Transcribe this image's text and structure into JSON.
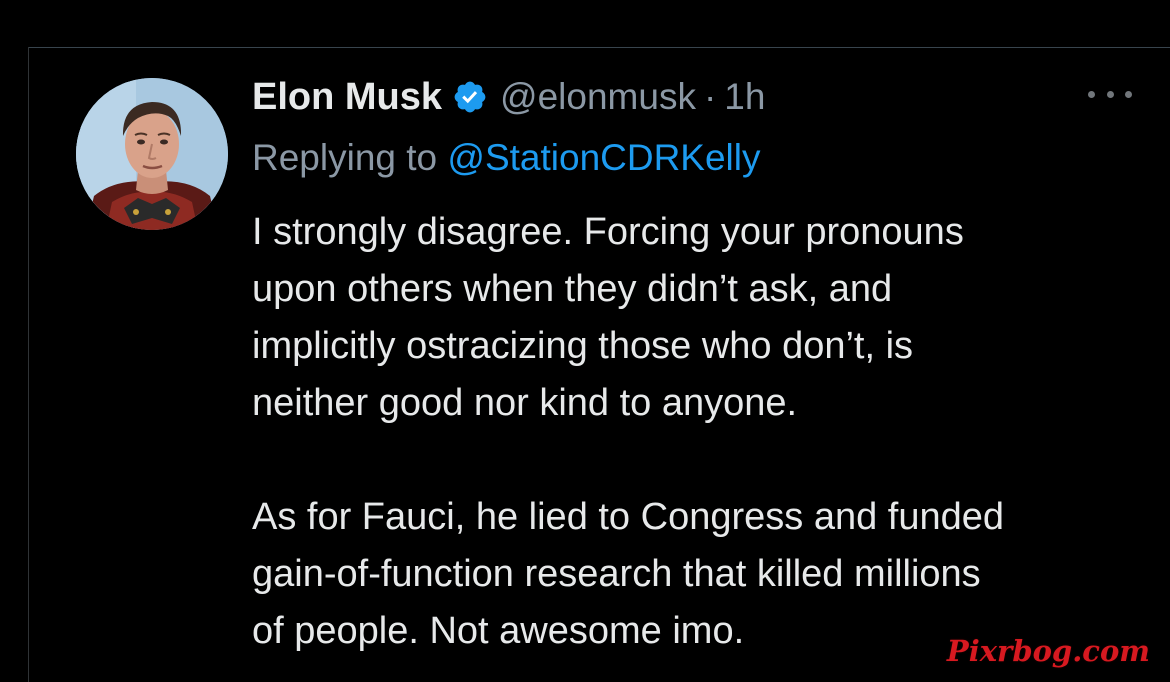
{
  "tweet": {
    "author": {
      "display_name": "Elon Musk",
      "verified": true,
      "verified_icon": "verified-badge-icon",
      "handle": "@elonmusk",
      "separator": "·",
      "time": "1h",
      "avatar_icon": "profile-photo"
    },
    "reply": {
      "prefix": "Replying to ",
      "mention": "@StationCDRKelly"
    },
    "body": {
      "paragraph_1": [
        "I strongly disagree. Forcing your pronouns",
        "upon others when they didn’t ask, and",
        "implicitly ostracizing those who don’t, is",
        "neither good nor kind to anyone."
      ],
      "paragraph_2": [
        "As for Fauci, he lied to Congress and funded",
        "gain-of-function research that killed millions",
        "of people. Not awesome imo."
      ]
    },
    "more_icon": "more-options-icon"
  },
  "watermark": "Pixrbog.com",
  "colors": {
    "background": "#000000",
    "primary_text": "#e7e9ea",
    "secondary_text": "#8b98a5",
    "accent": "#1d9bf0",
    "watermark": "#d71920"
  }
}
